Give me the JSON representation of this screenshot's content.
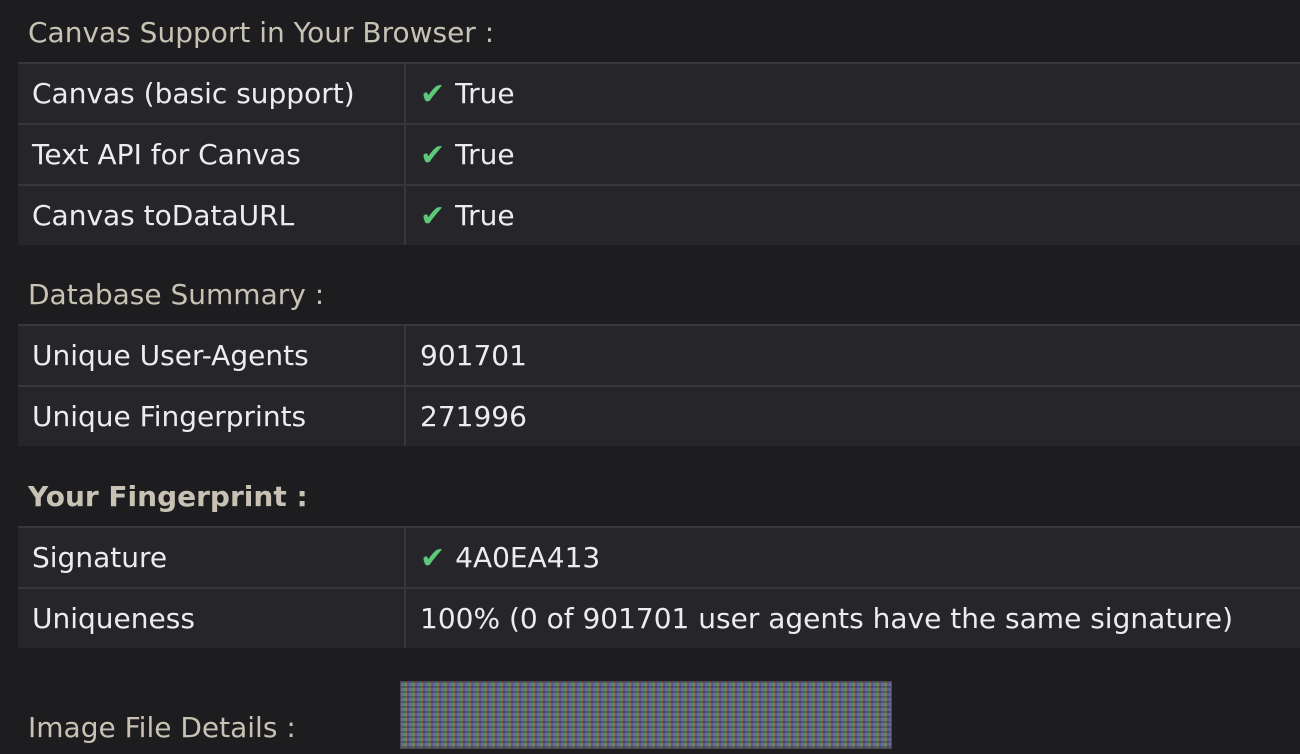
{
  "canvas_support": {
    "title": "Canvas Support in Your Browser :",
    "rows": [
      {
        "key": "Canvas (basic support)",
        "value": "True",
        "check": true
      },
      {
        "key": "Text API for Canvas",
        "value": "True",
        "check": true
      },
      {
        "key": "Canvas toDataURL",
        "value": "True",
        "check": true
      }
    ]
  },
  "database_summary": {
    "title": "Database Summary :",
    "rows": [
      {
        "key": "Unique User-Agents",
        "value": "901701"
      },
      {
        "key": "Unique Fingerprints",
        "value": "271996"
      }
    ]
  },
  "fingerprint": {
    "title": "Your Fingerprint :",
    "rows": [
      {
        "key": "Signature",
        "value": "4A0EA413",
        "check": true
      },
      {
        "key": "Uniqueness",
        "value": "100% (0 of 901701 user agents have the same signature)"
      }
    ]
  },
  "image_details": {
    "title": "Image File Details :"
  },
  "icons": {
    "check": "✔"
  },
  "colors": {
    "check": "#5cc87a",
    "section_title": "#c7c2b4",
    "background": "#1d1d1f",
    "table_bg": "#26262a"
  }
}
